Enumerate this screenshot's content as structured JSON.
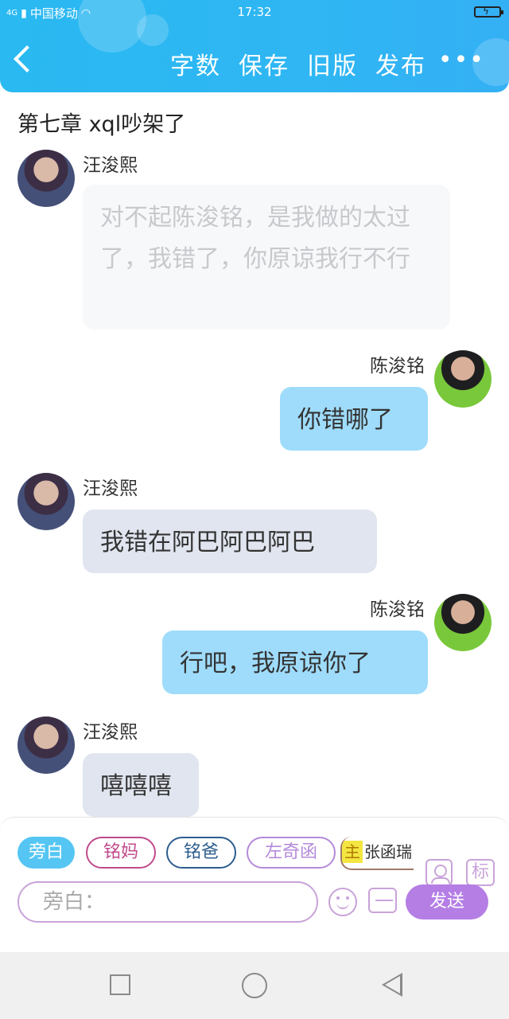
{
  "status_bar": {
    "carrier": "中国移动",
    "network": "4G",
    "time": "17:32"
  },
  "header": {
    "actions": [
      "字数",
      "保存",
      "旧版",
      "发布"
    ],
    "more_label": "•••"
  },
  "chapter_title": "第七章 xql吵架了",
  "messages": [
    {
      "side": "left",
      "name": "汪浚熙",
      "text": "对不起陈浚铭，是我做的太过了，我错了，你原谅我行不行"
    },
    {
      "side": "right",
      "name": "陈浚铭",
      "text": "你错哪了"
    },
    {
      "side": "left",
      "name": "汪浚熙",
      "text": "我错在阿巴阿巴阿巴"
    },
    {
      "side": "right",
      "name": "陈浚铭",
      "text": "行吧，我原谅你了"
    },
    {
      "side": "left",
      "name": "汪浚熙",
      "text": "嘻嘻嘻"
    }
  ],
  "composer": {
    "chips": [
      "旁白",
      "铭妈",
      "铭爸",
      "左奇函"
    ],
    "main_badge": "主",
    "main_name": "张函瑞",
    "label_button": "标",
    "input_placeholder": "旁白：",
    "send_label": "发送"
  },
  "colors": {
    "header_blue": "#2ab9f1",
    "bubble_right": "#9fdcfb",
    "bubble_left": "#e0e5ef",
    "send_purple": "#b47ee5"
  }
}
